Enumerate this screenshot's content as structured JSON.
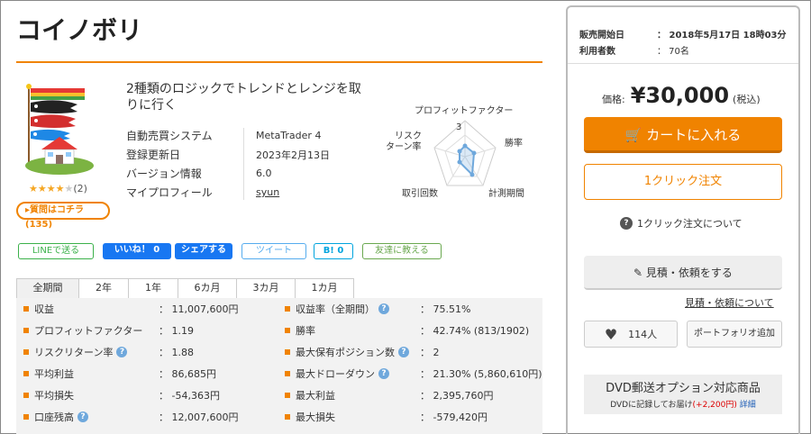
{
  "title": "コイノボリ",
  "product": {
    "description": "2種類のロジックでトレンドとレンジを取りに行く",
    "rating_count": "(2)",
    "rating_stars": 4,
    "question_button": "▸質問はコチラ(135)",
    "info": [
      {
        "key": "自動売買システム",
        "value": "MetaTrader 4"
      },
      {
        "key": "登録更新日",
        "value": "2023年2月13日"
      },
      {
        "key": "バージョン情報",
        "value": "6.0"
      },
      {
        "key": "マイプロフィール",
        "value": "syun"
      }
    ]
  },
  "radar": {
    "labels": {
      "pf": "プロフィットファクター",
      "win": "勝率",
      "period": "計測期間",
      "trades": "取引回数",
      "rr1": "リスク",
      "rr2": "ターン率"
    },
    "scale_max": "3"
  },
  "social": {
    "line": "LINEで送る",
    "like": "いいね！ 0",
    "share": "シェアする",
    "tweet": "ツイート",
    "hatena": "B! 0",
    "friend": "友達に教える"
  },
  "tabs": [
    "全期間",
    "2年",
    "1年",
    "6カ月",
    "3カ月",
    "1カ月"
  ],
  "stats": [
    {
      "lk": "収益",
      "lv": "： 11,007,600円",
      "rk": "収益率（全期間）",
      "rq": true,
      "rv": "： 75.51%"
    },
    {
      "lk": "プロフィットファクター",
      "lv": "： 1.19",
      "rk": "勝率",
      "rq": false,
      "rv": "： 42.74% (813/1902)"
    },
    {
      "lk": "リスクリターン率",
      "lq": true,
      "lv": "： 1.88",
      "rk": "最大保有ポジション数",
      "rq": true,
      "rv": "： 2"
    },
    {
      "lk": "平均利益",
      "lv": "： 86,685円",
      "rk": "最大ドローダウン",
      "rq": true,
      "rv": "： 21.30% (5,860,610円)"
    },
    {
      "lk": "平均損失",
      "lv": "： -54,363円",
      "rk": "最大利益",
      "rq": false,
      "rv": "： 2,395,760円"
    },
    {
      "lk": "口座残高",
      "lq": true,
      "lv": "： 12,007,600円",
      "rk": "最大損失",
      "rq": false,
      "rv": "： -579,420円"
    }
  ],
  "panel": {
    "sale_start_label": "販売開始日",
    "sale_start_value": "： 2018年5月17日 18時03分",
    "users_label": "利用者数",
    "users_value": "： 70名",
    "price_label": "価格:",
    "price_value": "¥30,000",
    "price_tax": "(税込)",
    "cart_button": "カートに入れる",
    "oneclick_button": "1クリック注文",
    "oneclick_about": "1クリック注文について",
    "estimate_button": "見積・依頼をする",
    "estimate_link": "見積・依頼について",
    "favorite_count": "114人",
    "portfolio_button": "ポートフォリオ追加",
    "dvd_title": "DVD郵送オプション対応商品",
    "dvd_sub_text": "DVDに記録してお届け",
    "dvd_sub_price": "(+2,200円)",
    "dvd_sub_link": "詳細"
  },
  "colors": {
    "accent": "#f08300",
    "facebook": "#1877f2",
    "line": "#3bb14a"
  }
}
